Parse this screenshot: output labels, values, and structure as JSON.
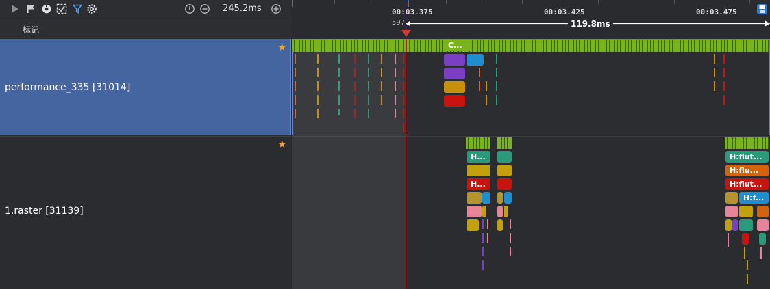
{
  "toolbar": {
    "zoom_value": "245.2ms",
    "icons": [
      "play-icon",
      "flag-icon",
      "bug-icon",
      "filter-check-icon",
      "filter-icon",
      "settings-icon",
      "timer-icon",
      "zoom-out-icon",
      "zoom-in-icon"
    ]
  },
  "marks_row": {
    "label": "标记"
  },
  "ruler": {
    "timestamps": [
      "00:03.375",
      "00:03.425",
      "00:03.475"
    ],
    "range_label": "119.8ms",
    "cursor_number": "597"
  },
  "processes": [
    {
      "name": "performance_335 [31014]",
      "starred": true,
      "selected": true
    },
    {
      "name": "1.raster [31139]",
      "starred": true,
      "selected": false
    }
  ],
  "slices": {
    "row1_c": "C...",
    "row2_left": [
      "H...",
      "H..."
    ],
    "row2_right": [
      "H:flut...",
      "H:flu...",
      "H:flut...",
      "H:f..."
    ]
  },
  "colors": {
    "selected_row": "#4565a0",
    "green": "#7ab31c",
    "purple": "#7a3fc4",
    "blue": "#1f8ed0",
    "orange": "#c9900d",
    "red": "#c8130e",
    "teal": "#2a9b7a",
    "mustard": "#c2a10d",
    "pink": "#e8849a",
    "cursor": "#d03a3a"
  }
}
